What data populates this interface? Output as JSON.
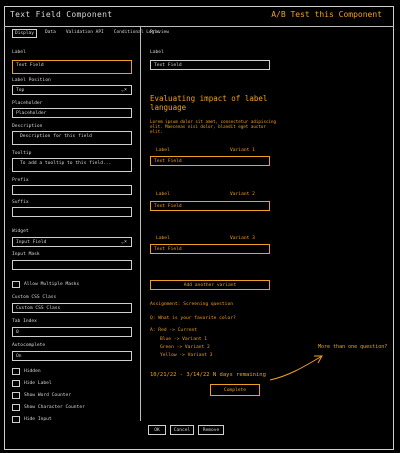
{
  "app": {
    "title": "Text Field Component",
    "ab_title": "A/B Test this Component"
  },
  "tabs": [
    "Display",
    "Data",
    "Validation API",
    "Conditional Logic"
  ],
  "preview": "Preview",
  "left": {
    "label": {
      "caption": "Label",
      "value": "Text Field"
    },
    "label_position": {
      "caption": "Label Position",
      "value": "Top"
    },
    "placeholder": {
      "caption": "Placeholder",
      "value": "Placeholder"
    },
    "description": {
      "caption": "Description",
      "value": "Description for this field"
    },
    "tooltip": {
      "caption": "Tooltip",
      "value": "To add a tooltip to this field..."
    },
    "prefix": {
      "caption": "Prefix"
    },
    "suffix": {
      "caption": "Suffix"
    },
    "widget": {
      "caption": "Widget",
      "value": "Input Field"
    },
    "input_mask": {
      "caption": "Input Mask"
    },
    "allow_multiple_masks": "Allow Multiple Masks",
    "custom_css_class": {
      "caption": "Custom CSS Class",
      "value": "Custom CSS Class"
    },
    "tab_index": {
      "caption": "Tab Index",
      "value": "0"
    },
    "autocomplete": {
      "caption": "Autocomplete",
      "value": "On"
    },
    "checks": [
      "Hidden",
      "Hide Label",
      "Show Word Counter",
      "Show Character Counter",
      "Hide Input"
    ]
  },
  "right": {
    "label_caption": "Label",
    "label_value": "Text Field",
    "section_title": "Evaluating impact of label language",
    "description": "Lorem ipsum dolor sit amet, consectetur adipiscing elit. Maecenas nisi dolor, blandit eget auctor elit.",
    "variants": [
      {
        "label": "Label",
        "variant": "Variant 1",
        "value": "Text Field"
      },
      {
        "label": "Label",
        "variant": "Variant 2",
        "value": "Text Field"
      },
      {
        "label": "Label",
        "variant": "Variant 3",
        "value": "Text Field"
      }
    ],
    "add_variant": "Add another variant",
    "assignment": "Assignment: Screening question",
    "question": "Q: What is your favorite color?",
    "answers": [
      "A: Red -> Current",
      "Blue -> Variant 1",
      "Green -> Variant 2",
      "Yellow -> Variant 3"
    ],
    "dates": "10/21/22 - 3/14/22   N days remaining",
    "complete_btn": "Complete",
    "more_question": "More than one question?"
  },
  "footer": {
    "ok": "OK",
    "cancel": "Cancel",
    "remove": "Remove"
  }
}
